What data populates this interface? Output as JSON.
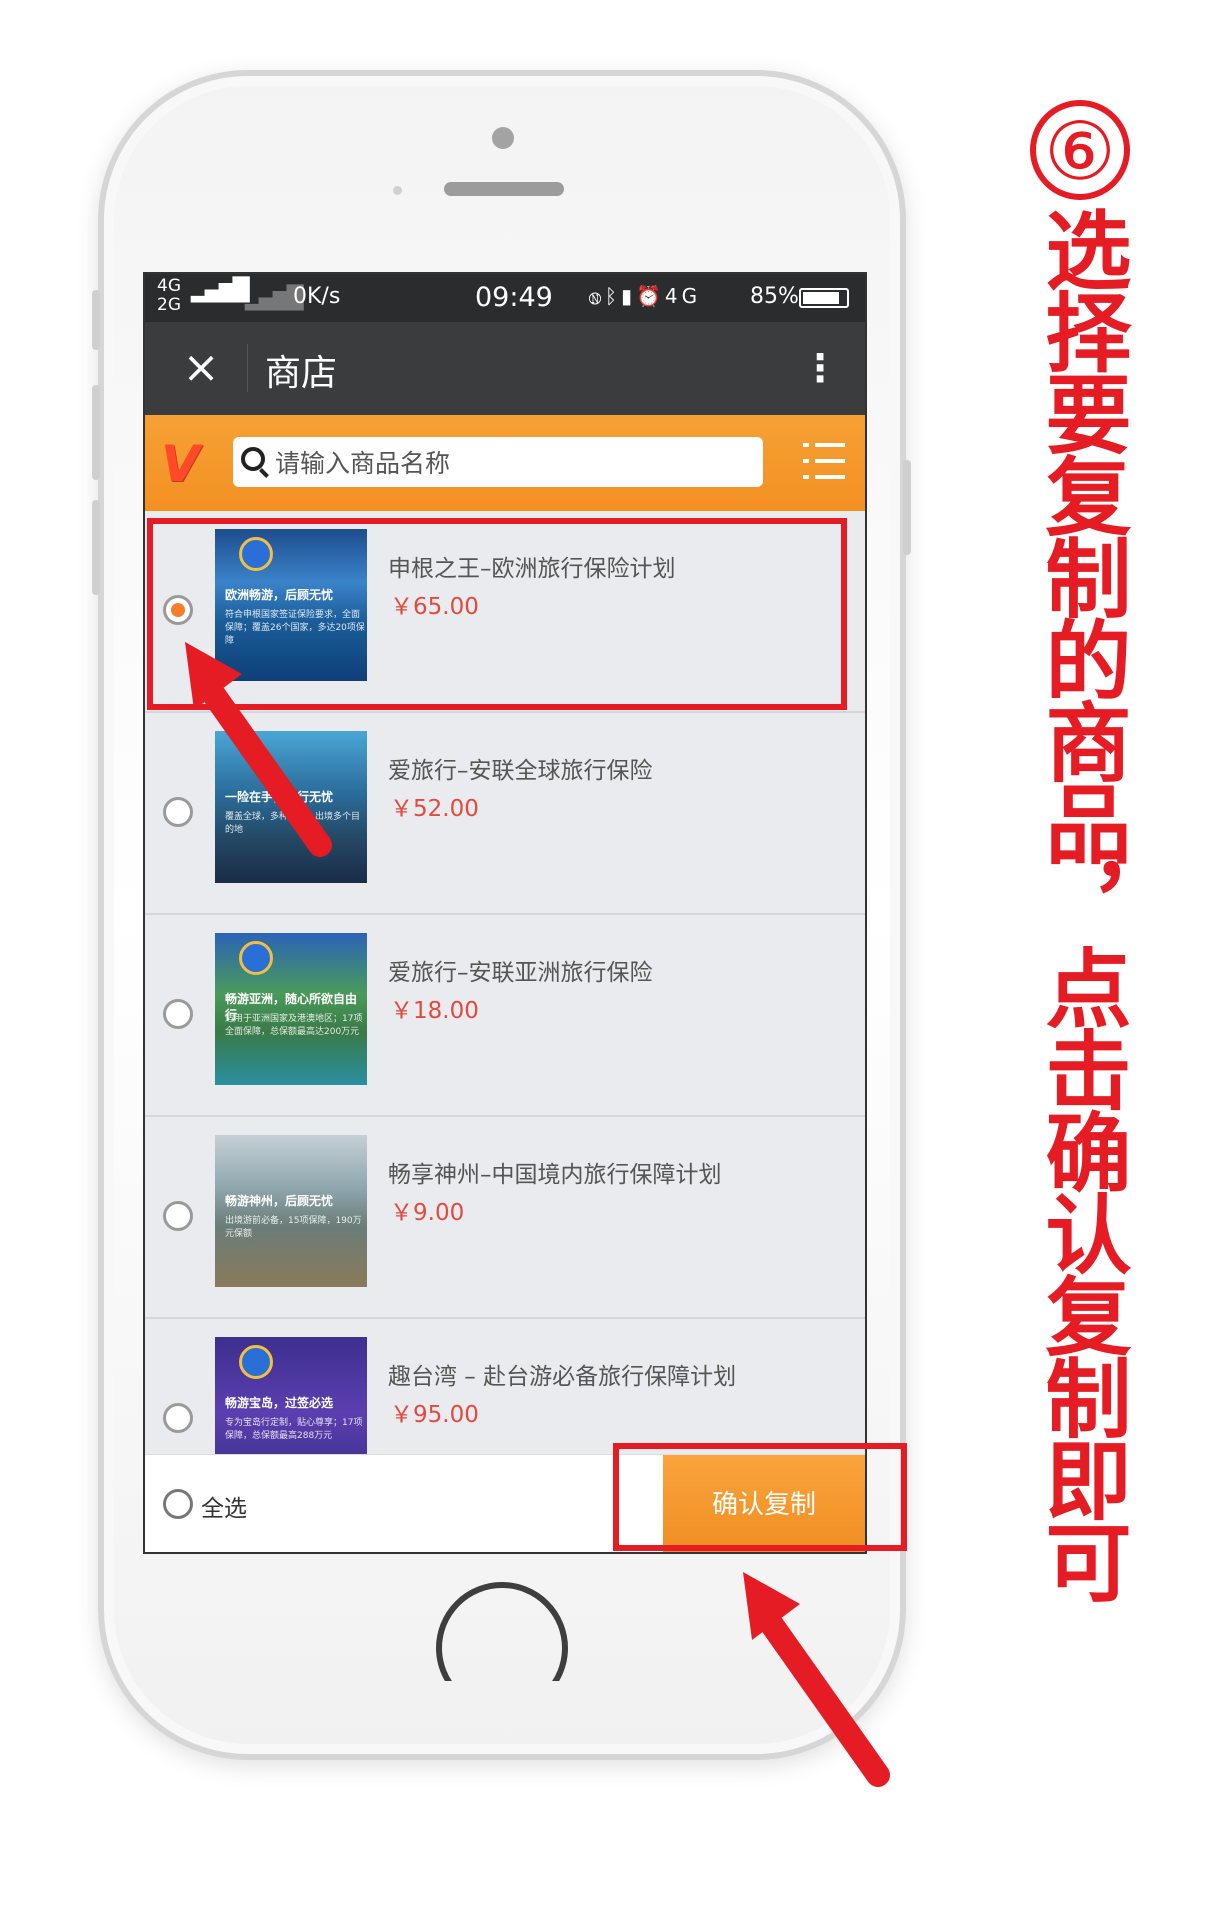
{
  "status_bar": {
    "signal_top": "4G",
    "signal_bottom": "2G",
    "speed": "0K/s",
    "time": "09:49",
    "network": "4G",
    "battery": "85%",
    "battery_level": 0.85
  },
  "title_bar": {
    "close_icon": "×",
    "title": "商店",
    "more_icon": "⋮"
  },
  "search": {
    "logo": "V",
    "placeholder": "请输入商品名称"
  },
  "products": [
    {
      "name": "申根之王–欧洲旅行保险计划",
      "price": "￥65.00",
      "selected": true,
      "thumb_caption": "欧洲畅游，后顾无忧",
      "thumb_sub": "符合申根国家签证保险要求，全面保障；覆盖26个国家，多达20项保障"
    },
    {
      "name": "爱旅行–安联全球旅行保险",
      "price": "￥52.00",
      "selected": false,
      "thumb_caption": "一险在手，旅行无忧",
      "thumb_sub": "覆盖全球，多种计划，出境多个目的地"
    },
    {
      "name": "爱旅行–安联亚洲旅行保险",
      "price": "￥18.00",
      "selected": false,
      "thumb_caption": "畅游亚洲，随心所欲自由行",
      "thumb_sub": "适用于亚洲国家及港澳地区；17项全面保障，总保额最高达200万元"
    },
    {
      "name": "畅享神州–中国境内旅行保障计划",
      "price": "￥9.00",
      "selected": false,
      "thumb_caption": "畅游神州，后顾无忧",
      "thumb_sub": "出境游前必备，15项保障，190万元保额"
    },
    {
      "name": "趣台湾 – 赴台游必备旅行保障计划",
      "price": "￥95.00",
      "selected": false,
      "thumb_caption": "畅游宝岛，过签必选",
      "thumb_sub": "专为宝岛行定制，贴心尊享；17项保障，总保额最高288万元"
    }
  ],
  "bottom_bar": {
    "select_all": "全选",
    "confirm": "确认复制"
  },
  "annotation": {
    "step": "⑥",
    "text": "选择要复制的商品，点击确认复制即可",
    "color": "#e51c23"
  },
  "colors": {
    "accent": "#f39023",
    "price": "#e34a3f",
    "highlight": "#e51c23"
  }
}
